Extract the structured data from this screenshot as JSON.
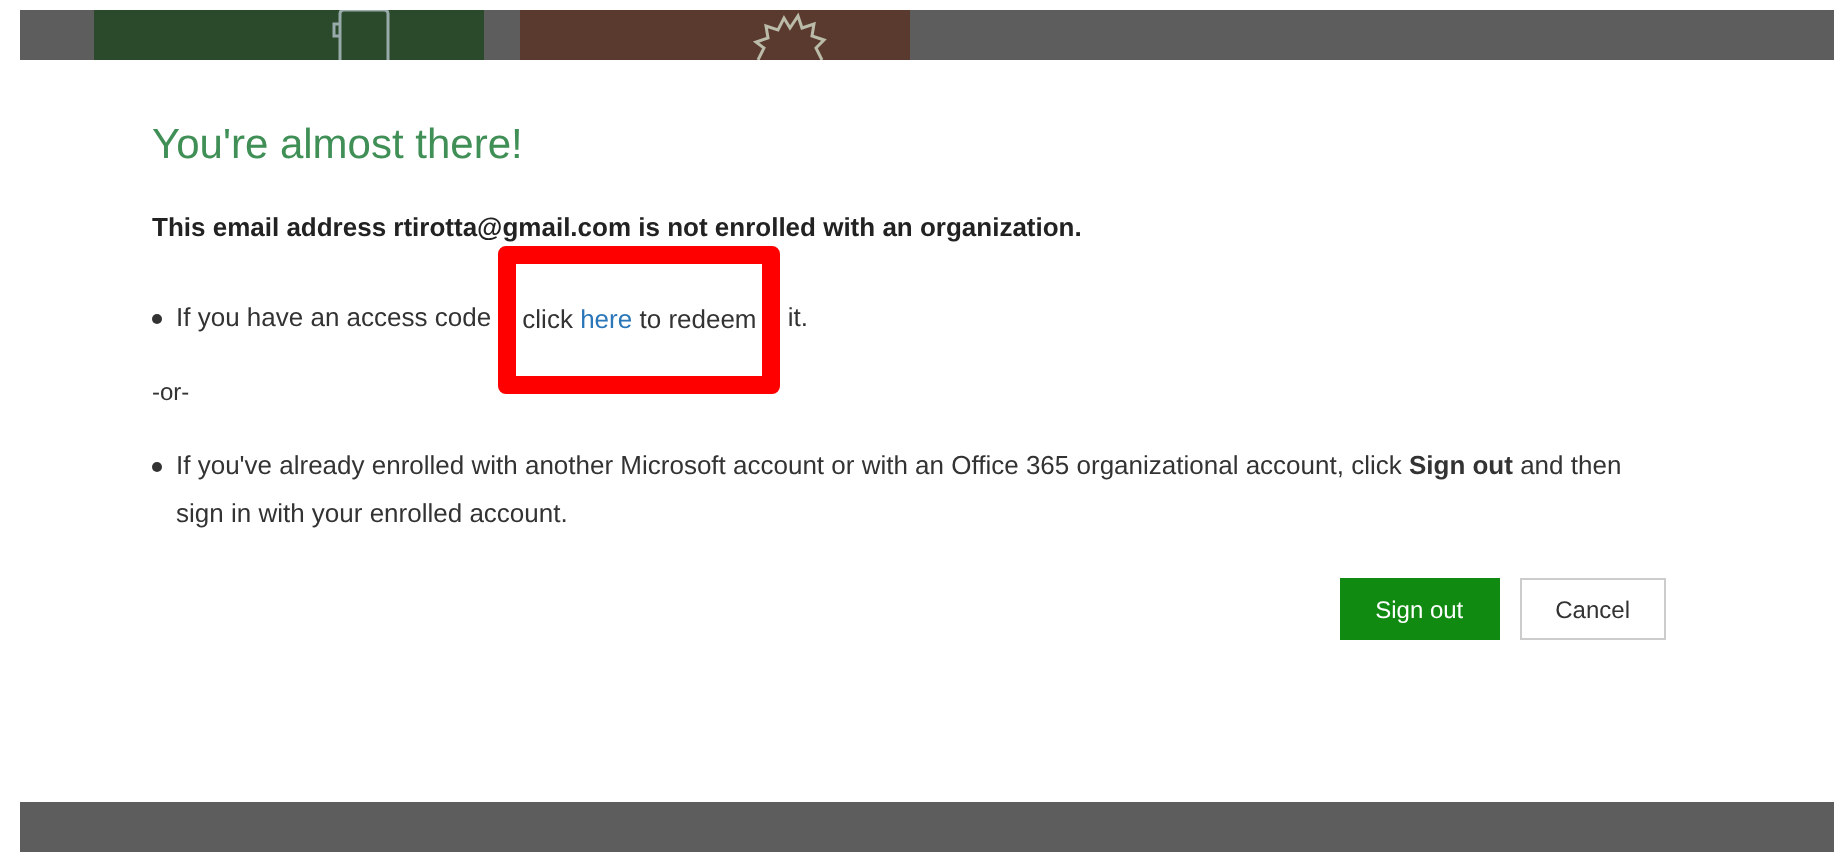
{
  "dialog": {
    "title": "You're almost there!",
    "message": "This email address rtirotta@gmail.com is not enrolled with an organization.",
    "items": [
      {
        "kind": "link-bullet",
        "before": "If you have an access code",
        "lead": "click",
        "link": "here",
        "trail": "to redeem",
        "after": "it."
      },
      {
        "kind": "separator",
        "text": "-or-"
      },
      {
        "kind": "bullet",
        "text": "If you've already enrolled with another Microsoft account or with an Office 365 organizational account, click **Sign out** and then sign in with your enrolled account."
      }
    ],
    "buttons": [
      {
        "label": "Sign out",
        "primary": true
      },
      {
        "label": "Cancel",
        "primary": false
      }
    ]
  },
  "annotation": {
    "kind": "highlight-box"
  }
}
